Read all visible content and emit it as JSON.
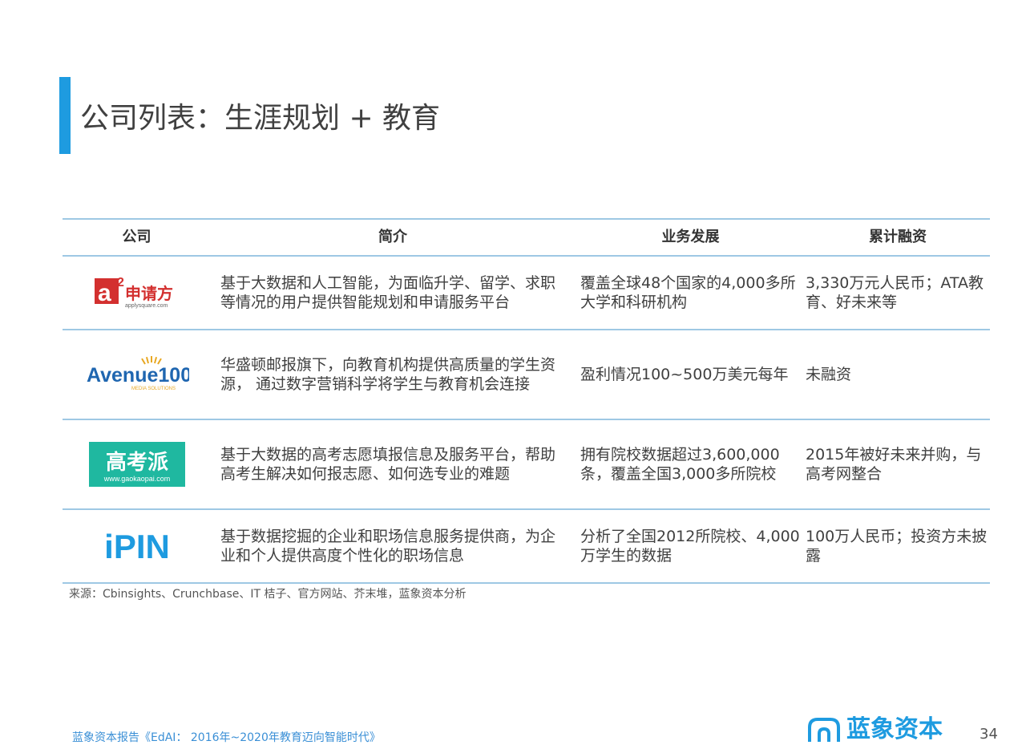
{
  "title": "公司列表：生涯规划 + 教育",
  "table": {
    "headers": [
      "公司",
      "简介",
      "业务发展",
      "累计融资"
    ],
    "rows": [
      {
        "logo_name": "申请方",
        "logo_url": "applysquare.com",
        "intro": "基于大数据和人工智能，为面临升学、留学、求职等情况的用户提供智能规划和申请服务平台",
        "business": "覆盖全球48个国家的4,000多所大学和科研机构",
        "funding": "3,330万元人民币；ATA教育、好未来等"
      },
      {
        "logo_name": "Avenue100",
        "logo_sub": "MEDIA SOLUTIONS",
        "intro": "华盛顿邮报旗下，向教育机构提供高质量的学生资源， 通过数字营销科学将学生与教育机会连接",
        "business": "盈利情况100~500万美元每年",
        "funding": "未融资"
      },
      {
        "logo_name": "高考派",
        "logo_url": "www.gaokaopai.com",
        "intro": "基于大数据的高考志愿填报信息及服务平台，帮助高考生解决如何报志愿、如何选专业的难题",
        "business": "拥有院校数据超过3,600,000条，覆盖全国3,000多所院校",
        "funding": "2015年被好未来并购，与高考网整合"
      },
      {
        "logo_name": "iPIN",
        "intro": "基于数据挖掘的企业和职场信息服务提供商，为企业和个人提供高度个性化的职场信息",
        "business": "分析了全国2012所院校、4,000万学生的数据",
        "funding": "100万人民币；投资方未披露"
      }
    ]
  },
  "source": "来源：Cbinsights、Crunchbase、IT 桔子、官方网站、芥末堆，蓝象资本分析",
  "footer": "蓝象资本报告《EdAI： 2016年~2020年教育迈向智能时代》",
  "brand": "蓝象资本",
  "page_number": "34",
  "colors": {
    "accent": "#1e9be0",
    "rule": "#9ec8e4",
    "applysquare_red": "#d3302f",
    "gaokaopai_teal": "#1fb8a0",
    "ipin_blue": "#1e9be0"
  }
}
